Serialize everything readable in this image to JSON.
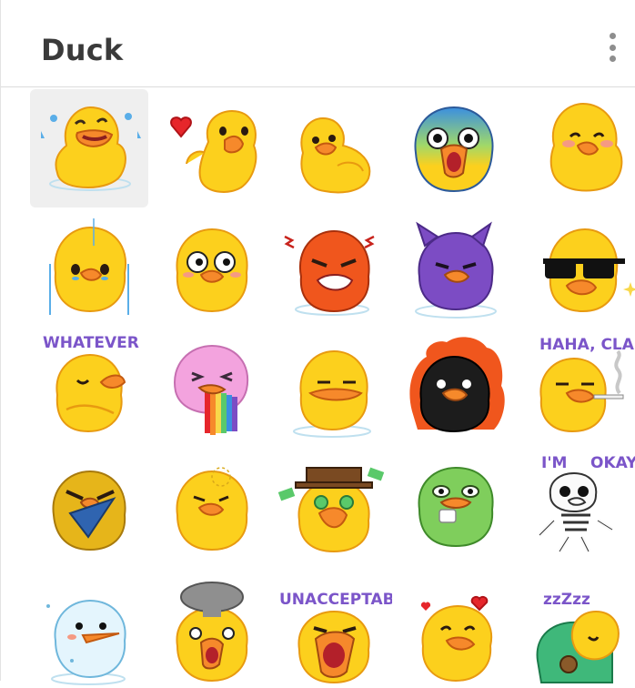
{
  "header": {
    "title": "Duck"
  },
  "stickers": [
    {
      "icon": "crying-laughing-duck-icon"
    },
    {
      "icon": "heart-duck-icon"
    },
    {
      "icon": "lounging-duck-icon"
    },
    {
      "icon": "shocked-duck-icon"
    },
    {
      "icon": "blushing-duck-icon"
    },
    {
      "icon": "crying-duck-icon"
    },
    {
      "icon": "wide-eyed-duck-icon"
    },
    {
      "icon": "angry-red-duck-icon"
    },
    {
      "icon": "devil-duck-icon"
    },
    {
      "icon": "sunglasses-duck-icon"
    },
    {
      "icon": "whatever-duck-icon",
      "caption": "WHATEVER"
    },
    {
      "icon": "rainbow-vomit-duck-icon"
    },
    {
      "icon": "unimpressed-duck-icon"
    },
    {
      "icon": "fire-black-duck-icon"
    },
    {
      "icon": "smoking-duck-icon",
      "caption": "HAHA, CLASSIC"
    },
    {
      "icon": "knife-duck-icon"
    },
    {
      "icon": "thinking-duck-icon"
    },
    {
      "icon": "money-duck-icon"
    },
    {
      "icon": "pepe-duck-icon"
    },
    {
      "icon": "skeleton-duck-icon",
      "caption1": "I'M",
      "caption2": "OKAY"
    },
    {
      "icon": "snowman-duck-icon"
    },
    {
      "icon": "mind-blown-duck-icon"
    },
    {
      "icon": "unacceptable-duck-icon",
      "caption": "UNACCEPTABLE"
    },
    {
      "icon": "kissing-duck-icon"
    },
    {
      "icon": "sleeping-duck-icon",
      "caption": "zzZzz"
    }
  ],
  "colors": {
    "yellow": "#fcd01d",
    "orange": "#f6892b",
    "selected": "#efefef"
  }
}
